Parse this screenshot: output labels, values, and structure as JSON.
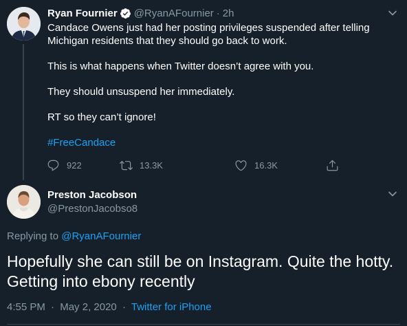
{
  "tweet": {
    "author_name": "Ryan Fournier",
    "author_handle": "@RyanAFournier",
    "separator": "·",
    "age": "2h",
    "paragraphs": [
      "Candace Owens just had her posting privileges suspended after telling Michigan residents that they should go back to work.",
      "This is what happens when Twitter doesn’t agree with you.",
      "They should unsuspend her immediately.",
      "RT so they can’t ignore!"
    ],
    "hashtag": "#FreeCandace",
    "replies": "922",
    "retweets": "13.3K",
    "likes": "16.3K"
  },
  "reply": {
    "author_name": "Preston Jacobson",
    "author_handle": "@PrestonJacobso8",
    "replying_to_label": "Replying to",
    "replying_to_handle": "@RyanAFournier",
    "text": "Hopefully she can still be on Instagram. Quite the hotty. Getting into ebony recently",
    "time": "4:55 PM",
    "separator": "·",
    "date": "May 2, 2020",
    "source": "Twitter for iPhone"
  },
  "colors": {
    "background": "#15202b",
    "text": "#ffffff",
    "muted": "#8899a6",
    "accent": "#1da1f2",
    "border": "#38444d"
  },
  "icons": [
    "verified-badge-icon",
    "chevron-down-icon",
    "reply-icon",
    "retweet-icon",
    "like-icon",
    "share-icon"
  ]
}
